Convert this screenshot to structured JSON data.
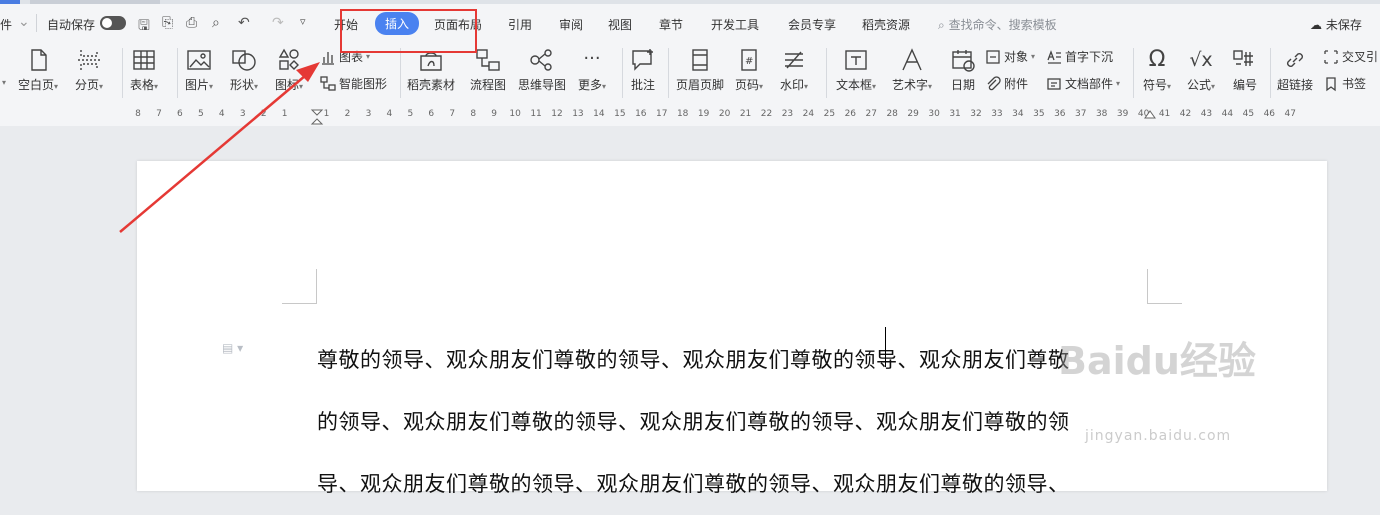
{
  "menubar": {
    "file_fragment": "件",
    "autosave_label": "自动保存",
    "tabs": [
      {
        "label": "开始",
        "active": false
      },
      {
        "label": "插入",
        "active": true
      },
      {
        "label": "页面布局",
        "active": false
      },
      {
        "label": "引用",
        "active": false
      },
      {
        "label": "审阅",
        "active": false
      },
      {
        "label": "视图",
        "active": false
      },
      {
        "label": "章节",
        "active": false
      },
      {
        "label": "开发工具",
        "active": false
      },
      {
        "label": "会员专享",
        "active": false
      },
      {
        "label": "稻壳资源",
        "active": false
      }
    ],
    "search_placeholder": "查找命令、搜索模板",
    "unsaved_label": "未保存"
  },
  "ribbon": {
    "blank_page": "空白页",
    "page_break": "分页",
    "table": "表格",
    "picture": "图片",
    "shape": "形状",
    "icon_lib": "图标",
    "chart": "图表",
    "smart_art": "智能图形",
    "docer_material": "稻壳素材",
    "flowchart": "流程图",
    "mindmap": "思维导图",
    "more": "更多",
    "comment": "批注",
    "header_footer": "页眉页脚",
    "page_number": "页码",
    "watermark": "水印",
    "textbox": "文本框",
    "wordart": "艺术字",
    "date": "日期",
    "object": "对象",
    "attachment": "附件",
    "dropcap": "首字下沉",
    "doc_parts": "文档部件",
    "symbol": "符号",
    "formula": "公式",
    "numbering": "编号",
    "hyperlink": "超链接",
    "cross_ref": "交叉引",
    "bookmark": "书签"
  },
  "ruler": {
    "numbers": [
      "8",
      "7",
      "6",
      "5",
      "4",
      "3",
      "2",
      "1",
      "",
      "1",
      "2",
      "3",
      "4",
      "5",
      "6",
      "7",
      "8",
      "9",
      "10",
      "11",
      "12",
      "13",
      "14",
      "15",
      "16",
      "17",
      "18",
      "19",
      "20",
      "21",
      "22",
      "23",
      "24",
      "25",
      "26",
      "27",
      "28",
      "29",
      "30",
      "31",
      "32",
      "33",
      "34",
      "35",
      "36",
      "37",
      "38",
      "39",
      "40",
      "41",
      "42",
      "43",
      "44",
      "45",
      "46",
      "47"
    ]
  },
  "document": {
    "lines": [
      "尊敬的领导、观众朋友们尊敬的领导、观众朋友们尊敬的领导、观众朋友们尊敬",
      "的领导、观众朋友们尊敬的领导、观众朋友们尊敬的领导、观众朋友们尊敬的领",
      "导、观众朋友们尊敬的领导、观众朋友们尊敬的领导、观众朋友们尊敬的领导、"
    ]
  },
  "watermark": {
    "brand": "Baidu经验",
    "site": "jingyan.baidu.com"
  },
  "colors": {
    "accent": "#4a82f0",
    "annotation": "#e53935"
  }
}
